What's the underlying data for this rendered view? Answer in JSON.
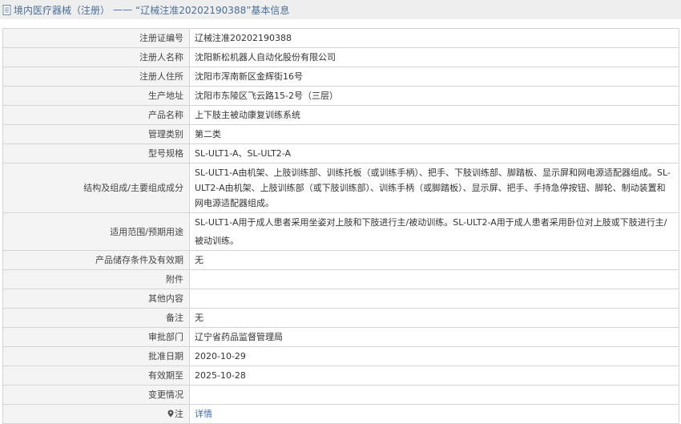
{
  "header": {
    "category": "境内医疗器械（注册）",
    "separator": "——",
    "title": "“辽械注准20202190388”基本信息"
  },
  "rows": [
    {
      "label": "注册证编号",
      "value": "辽械注准20202190388"
    },
    {
      "label": "注册人名称",
      "value": "沈阳新松机器人自动化股份有限公司"
    },
    {
      "label": "注册人住所",
      "value": "沈阳市浑南新区金辉街16号"
    },
    {
      "label": "生产地址",
      "value": "沈阳市东陵区飞云路15-2号（三层）"
    },
    {
      "label": "产品名称",
      "value": "上下肢主被动康复训练系统"
    },
    {
      "label": "管理类别",
      "value": "第二类"
    },
    {
      "label": "型号规格",
      "value": "SL-ULT1-A、SL-ULT2-A"
    },
    {
      "label": "结构及组成/主要组成成分",
      "value": "SL-ULT1-A由机架、上肢训练部、训练托板（或训练手柄）、把手、下肢训练部、脚踏板、显示屏和网电源适配器组成。SL-ULT2-A由机架、上肢训练部（或下肢训练部）、训练手柄（或脚踏板）、显示屏、把手、手持急停按钮、脚轮、制动装置和网电源适配器组成。"
    },
    {
      "label": "适用范围/预期用途",
      "value": "SL-ULT1-A用于成人患者采用坐姿对上肢和下肢进行主/被动训练。SL-ULT2-A用于成人患者采用卧位对上肢或下肢进行主/被动训练。"
    },
    {
      "label": "产品储存条件及有效期",
      "value": "无"
    },
    {
      "label": "附件",
      "value": ""
    },
    {
      "label": "其他内容",
      "value": ""
    },
    {
      "label": "备注",
      "value": "无"
    },
    {
      "label": "审批部门",
      "value": "辽宁省药品监督管理局"
    },
    {
      "label": "批准日期",
      "value": "2020-10-29"
    },
    {
      "label": "有效期至",
      "value": "2025-10-28"
    },
    {
      "label": "变更情况",
      "value": ""
    },
    {
      "label": "注",
      "value": "详情"
    }
  ],
  "colors": {
    "header_bg": "#eeeeee",
    "header_text": "#4a6f96",
    "label_bg": "#f4f4f4",
    "border": "#d4d4d4",
    "link": "#3a6fb0"
  },
  "icons": {
    "header": "document-icon",
    "note": "location-pin-icon"
  }
}
